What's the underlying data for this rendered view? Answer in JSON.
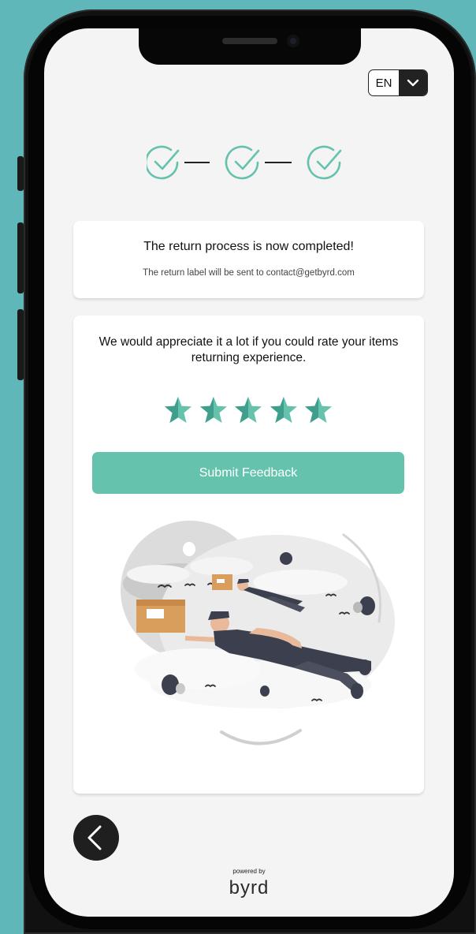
{
  "language": {
    "code": "EN"
  },
  "steps": {
    "count": 3,
    "completed": 3,
    "color": "#65c2ad"
  },
  "confirmation": {
    "title": "The return process is now completed!",
    "subtitle": "The return label will be sent to contact@getbyrd.com"
  },
  "feedback": {
    "prompt": "We would appreciate it a lot if you could rate your items returning experience.",
    "rating": {
      "value": 5,
      "max": 5
    },
    "submit_label": "Submit Feedback"
  },
  "footer": {
    "powered_by": "powered by",
    "brand": "byrd"
  },
  "colors": {
    "accent": "#65c2ad",
    "background": "#5fb7ba",
    "screen": "#f4f4f4"
  }
}
